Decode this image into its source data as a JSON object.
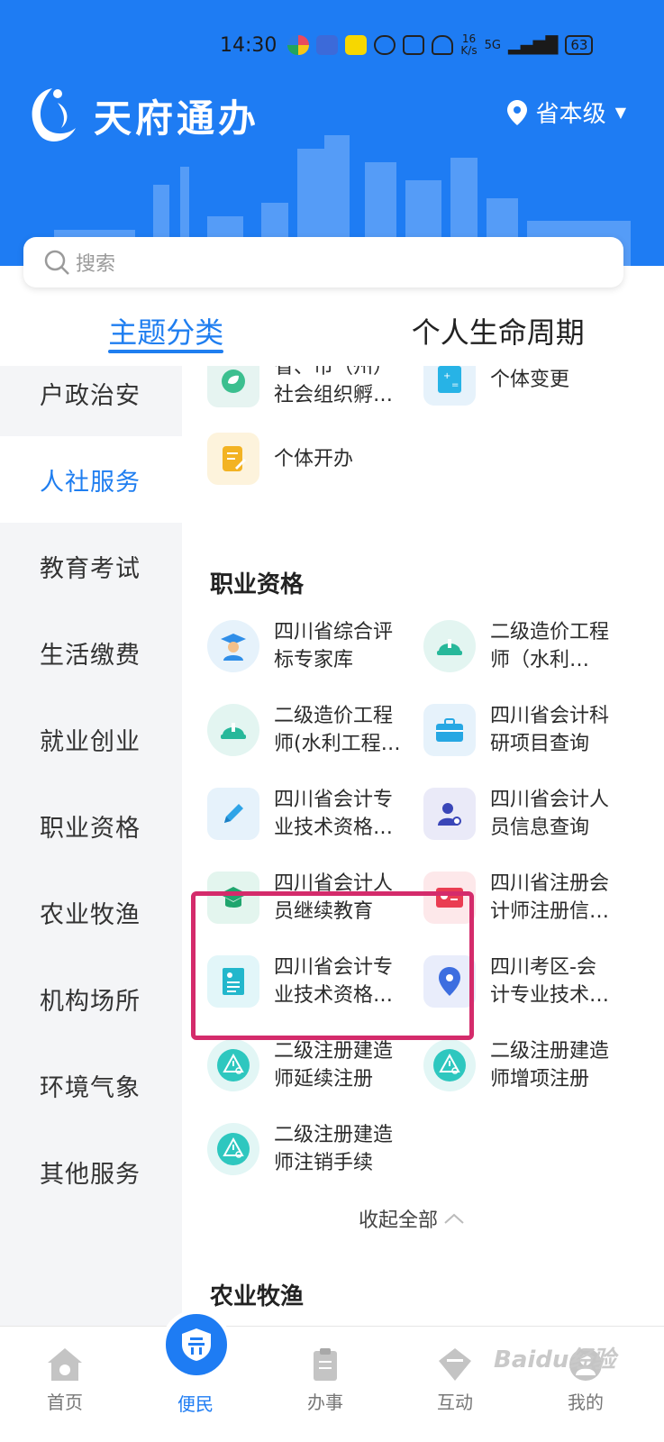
{
  "status_bar": {
    "time": "14:30",
    "speed_top": "16",
    "speed_unit": "K/s",
    "network": "5G",
    "battery": "63"
  },
  "header": {
    "app_name": "天府通办",
    "location": "省本级",
    "brand_color": "#1e7cf3"
  },
  "search": {
    "placeholder": "搜索"
  },
  "tabs": [
    {
      "label": "主题分类",
      "active": true
    },
    {
      "label": "个人生命周期",
      "active": false
    }
  ],
  "sidebar": {
    "items": [
      "户政治安",
      "人社服务",
      "教育考试",
      "生活缴费",
      "就业创业",
      "职业资格",
      "农业牧渔",
      "机构场所",
      "环境气象",
      "其他服务"
    ],
    "active": "人社服务"
  },
  "content": {
    "top_items": [
      {
        "label": "省、市（州）\n社会组织孵…",
        "icon": "leaf-shield-icon"
      },
      {
        "label": "个体变更",
        "icon": "calculator-icon"
      },
      {
        "label": "个体开办",
        "icon": "document-edit-icon"
      }
    ],
    "section_title": "职业资格",
    "items": [
      {
        "label": "四川省综合评\n标专家库",
        "icon": "graduate-icon"
      },
      {
        "label": "二级造价工程\n师（水利…",
        "icon": "helmet-icon"
      },
      {
        "label": "二级造价工程\n师(水利工程…",
        "icon": "helmet-icon"
      },
      {
        "label": "四川省会计科\n研项目查询",
        "icon": "briefcase-icon"
      },
      {
        "label": "四川省会计专\n业技术资格…",
        "icon": "pencil-icon"
      },
      {
        "label": "四川省会计人\n员信息查询",
        "icon": "person-search-icon"
      },
      {
        "label": "四川省会计人\n员继续教育",
        "icon": "graduation-cap-icon"
      },
      {
        "label": "四川省注册会\n计师注册信…",
        "icon": "id-card-icon"
      },
      {
        "label": "四川省会计专\n业技术资格…",
        "icon": "certificate-icon"
      },
      {
        "label": "四川考区-会\n计专业技术…",
        "icon": "location-pin-icon"
      },
      {
        "label": "二级注册建造\n师延续注册",
        "icon": "warning-search-icon"
      },
      {
        "label": "二级注册建造\n师增项注册",
        "icon": "warning-search-icon"
      },
      {
        "label": "二级注册建造\n师注销手续",
        "icon": "warning-search-icon"
      }
    ],
    "collapse_label": "收起全部",
    "next_section": "农业牧渔"
  },
  "bottom_nav": [
    {
      "label": "首页",
      "icon": "home-icon"
    },
    {
      "label": "便民",
      "icon": "temple-icon",
      "active": true
    },
    {
      "label": "办事",
      "icon": "clipboard-icon"
    },
    {
      "label": "互动",
      "icon": "diamond-icon"
    },
    {
      "label": "我的",
      "icon": "user-icon"
    }
  ],
  "watermark": "Baidu经验"
}
